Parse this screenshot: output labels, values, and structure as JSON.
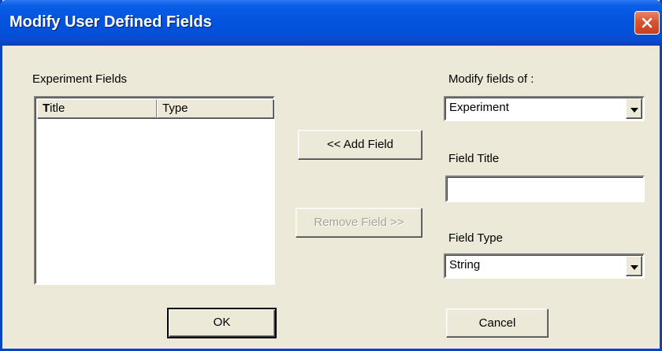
{
  "window": {
    "title": "Modify User Defined Fields"
  },
  "experiment_fields": {
    "label": "Experiment Fields",
    "columns": [
      {
        "label_accel": "T",
        "label_rest": "itle"
      },
      {
        "label": "Type"
      }
    ],
    "rows": []
  },
  "buttons": {
    "add_field": "<< Add Field",
    "remove_field": "Remove Field >>",
    "ok": "OK",
    "cancel": "Cancel"
  },
  "modify_fields_of": {
    "label": "Modify fields of :",
    "value": "Experiment"
  },
  "field_title": {
    "label": "Field Title",
    "value": "",
    "placeholder": ""
  },
  "field_type": {
    "label": "Field Type",
    "value": "String"
  },
  "icons": {
    "close": "close-icon",
    "dropdown": "chevron-down-icon"
  },
  "colors": {
    "titlebar": "#0554E0",
    "dialog_bg": "#ECE9D8",
    "close_button": "#D8542F",
    "disabled_text": "#A7A39A"
  }
}
